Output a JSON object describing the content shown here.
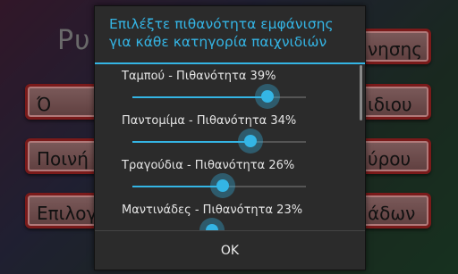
{
  "background": {
    "title": "Ρυ",
    "buttons": [
      {
        "left": "",
        "right": "νησης"
      },
      {
        "left": "Ό",
        "right": "ιδιου"
      },
      {
        "left": "Ποινή",
        "right": "ύρου"
      },
      {
        "left": "Επιλογ",
        "right": "άδων"
      }
    ]
  },
  "dialog": {
    "title_line1": "Επιλέξτε πιθανότητα εμφάνισης",
    "title_line2": "για κάθε κατηγορία παιχνιδιών",
    "items": [
      {
        "label": "Ταμπού - Πιθανότητα 39%",
        "value": 39
      },
      {
        "label": "Παντομίμα - Πιθανότητα 34%",
        "value": 34
      },
      {
        "label": "Τραγούδια - Πιθανότητα 26%",
        "value": 26
      },
      {
        "label": "Μαντινάδες - Πιθανότητα 23%",
        "value": 23
      }
    ],
    "ok_label": "OK",
    "accent_color": "#34b5e5"
  }
}
